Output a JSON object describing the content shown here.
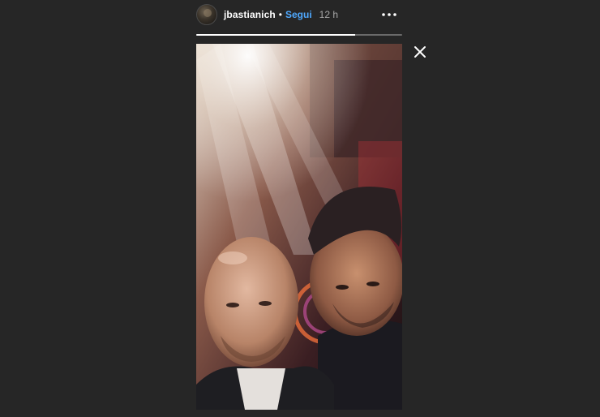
{
  "header": {
    "username": "jbastianich",
    "separator": "•",
    "follow_label": "Segui",
    "time_ago": "12 h"
  },
  "story": {
    "progress": 0.77,
    "image_description_icon": "photo"
  },
  "icons": {
    "more": "more-horizontal-icon",
    "close": "close-icon"
  },
  "colors": {
    "background": "#262626",
    "follow": "#4fa9ff",
    "time": "#a8a8a8",
    "progress_track": "#6a6a6a",
    "progress_fill": "#ffffff"
  }
}
